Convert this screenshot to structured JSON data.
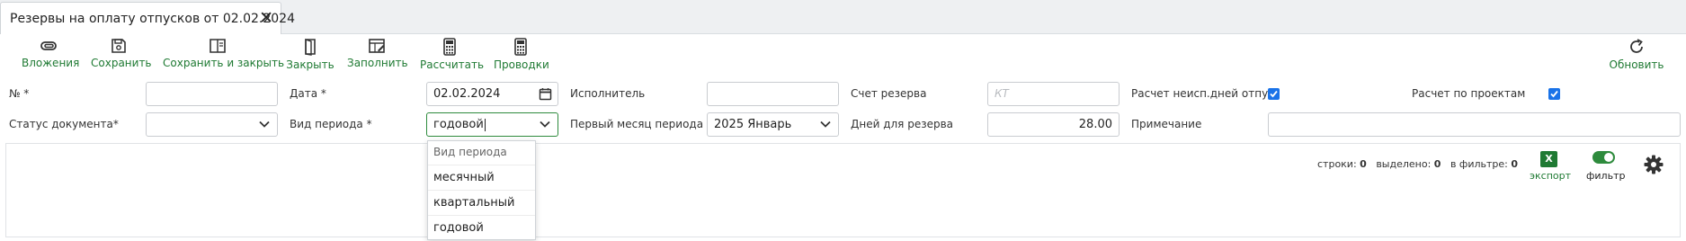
{
  "tab": {
    "title": "Резервы на оплату отпусков от 02.02.2024",
    "close_icon": "close-icon"
  },
  "toolbar": {
    "attachments": "Вложения",
    "save": "Сохранить",
    "save_close": "Сохранить и закрыть",
    "close": "Закрыть",
    "fill": "Заполнить",
    "calculate": "Рассчитать",
    "postings": "Проводки",
    "refresh": "Обновить",
    "accent_color": "#1f7a33"
  },
  "form": {
    "number_label": "№ *",
    "number_value": "",
    "date_label": "Дата *",
    "date_value": "02.02.2024",
    "executor_label": "Исполнитель",
    "executor_value": "",
    "reserve_account_label": "Счет резерва",
    "reserve_account_placeholder": "КТ",
    "unused_days_label": "Расчет неисп.дней отпу...",
    "unused_days_checked": true,
    "by_projects_label": "Расчет по проектам",
    "by_projects_checked": true,
    "status_label": "Статус документа*",
    "status_value": "",
    "period_type_label": "Вид периода *",
    "period_type_value": "годовой",
    "first_month_label": "Первый месяц периода *",
    "first_month_value": "2025 Январь",
    "reserve_days_label": "Дней для резерва",
    "reserve_days_value": "28.00",
    "note_label": "Примечание",
    "note_value": ""
  },
  "grid_status": {
    "rows_label": "строки:",
    "rows_value": "0",
    "selected_label": "выделено:",
    "selected_value": "0",
    "filtered_label": "в фильтре:",
    "filtered_value": "0",
    "excel_letter": "X",
    "export_label": "экспорт",
    "filter_label": "фильтр",
    "filter_on": true
  },
  "dropdown": {
    "header": "Вид периода",
    "options": [
      "месячный",
      "квартальный",
      "годовой"
    ]
  }
}
